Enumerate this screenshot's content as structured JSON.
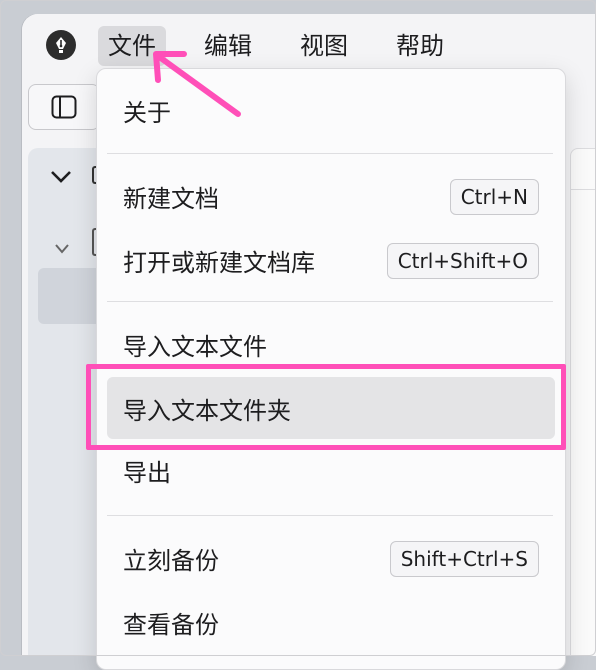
{
  "menubar": {
    "logo_icon": "fountain-pen-icon",
    "items": [
      "文件",
      "编辑",
      "视图",
      "帮助"
    ],
    "active_index": 0
  },
  "dropdown": {
    "about": "关于",
    "new_doc": {
      "label": "新建文档",
      "shortcut": "Ctrl+N"
    },
    "open_lib": {
      "label": "打开或新建文档库",
      "shortcut": "Ctrl+Shift+O"
    },
    "import_text_file": "导入文本文件",
    "import_text_folder": "导入文本文件夹",
    "export": "导出",
    "backup_now": {
      "label": "立刻备份",
      "shortcut": "Shift+Ctrl+S"
    },
    "view_backups": "查看备份"
  },
  "annotation": {
    "color": "#ff4fb8"
  }
}
